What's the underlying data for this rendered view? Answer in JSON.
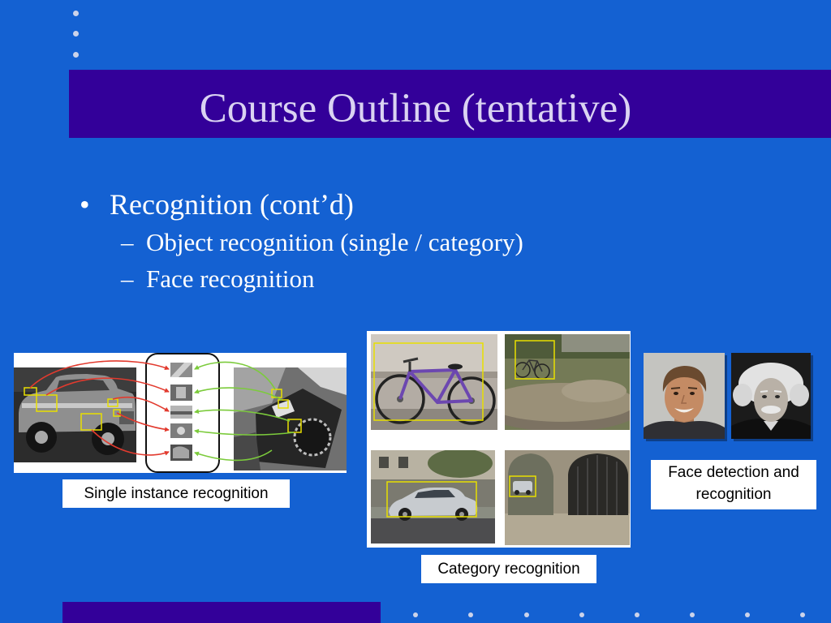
{
  "theme": {
    "background": "#1461D2",
    "title_bar": "#330099",
    "title_text": "#DAD3F2",
    "body_text": "#FFFFFF",
    "accent_bar": "#330099",
    "decor_dot": "#CCD3EA",
    "detection_box": "#E8DF00",
    "match_arrow_red": "#E23A2E",
    "match_arrow_green": "#7CCB3C"
  },
  "slide": {
    "title": "Course Outline (tentative)"
  },
  "outline": {
    "items": [
      {
        "marker": "•",
        "text": "Recognition (cont’d)",
        "subitems": [
          {
            "marker": "–",
            "text": "Object recognition (single / category)"
          },
          {
            "marker": "–",
            "text": "Face recognition"
          }
        ]
      }
    ]
  },
  "figures": {
    "single_instance": {
      "caption": "Single instance recognition"
    },
    "category": {
      "caption": "Category recognition"
    },
    "faces": {
      "caption": "Face detection and recognition"
    }
  }
}
